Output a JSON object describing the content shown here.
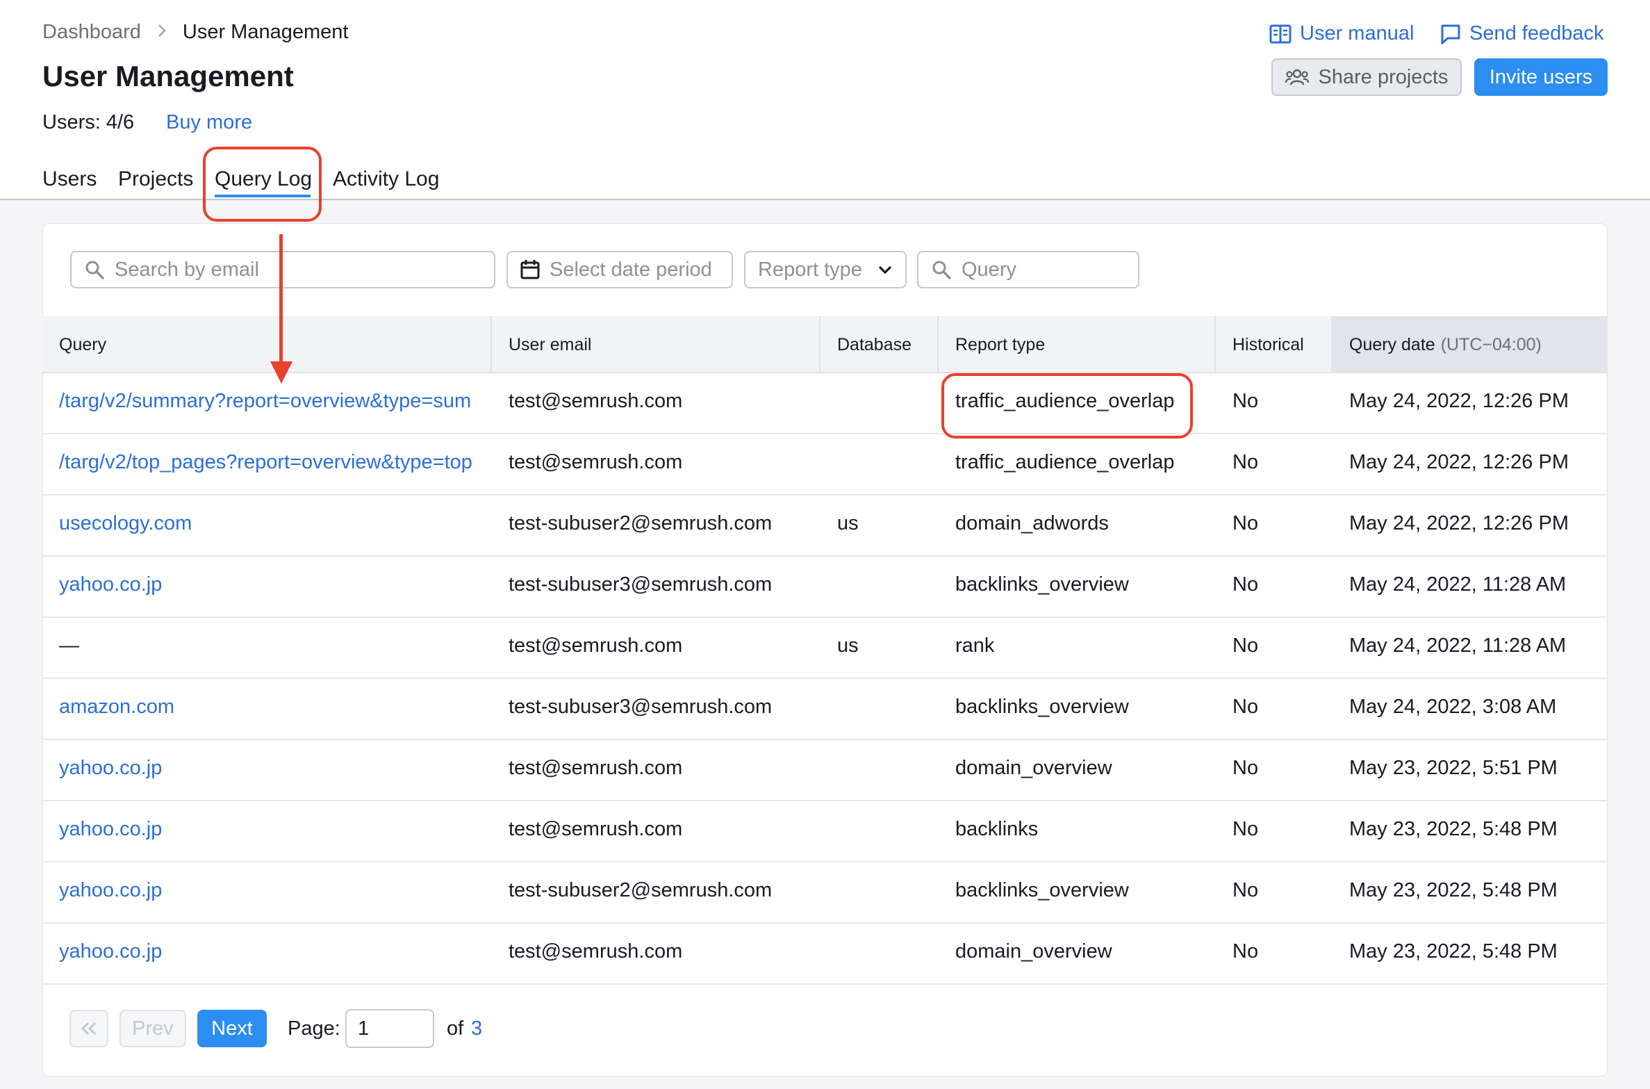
{
  "breadcrumb": {
    "root": "Dashboard",
    "current": "User Management"
  },
  "page": {
    "title": "User Management",
    "users_count": "Users: 4/6",
    "buy_more": "Buy more"
  },
  "top_links": {
    "manual": "User manual",
    "feedback": "Send feedback"
  },
  "actions": {
    "share": "Share projects",
    "invite": "Invite users"
  },
  "tabs": [
    {
      "label": "Users"
    },
    {
      "label": "Projects"
    },
    {
      "label": "Query Log",
      "active": true
    },
    {
      "label": "Activity Log"
    }
  ],
  "filters": {
    "search_email_placeholder": "Search by email",
    "date_period_placeholder": "Select date period",
    "report_type": "Report type",
    "query_placeholder": "Query"
  },
  "table": {
    "headers": {
      "query": "Query",
      "user_email": "User email",
      "database": "Database",
      "report_type": "Report type",
      "historical": "Historical",
      "query_date": "Query date",
      "query_date_tz": "(UTC−04:00)"
    },
    "rows": [
      {
        "query": "/targ/v2/summary?report=overview&type=sum",
        "email": "test@semrush.com",
        "database": "",
        "report_type": "traffic_audience_overlap",
        "historical": "No",
        "date": "May 24, 2022, 12:26 PM"
      },
      {
        "query": "/targ/v2/top_pages?report=overview&type=top",
        "email": "test@semrush.com",
        "database": "",
        "report_type": "traffic_audience_overlap",
        "historical": "No",
        "date": "May 24, 2022, 12:26 PM"
      },
      {
        "query": "usecology.com",
        "email": "test-subuser2@semrush.com",
        "database": "us",
        "report_type": "domain_adwords",
        "historical": "No",
        "date": "May 24, 2022, 12:26 PM"
      },
      {
        "query": "yahoo.co.jp",
        "email": "test-subuser3@semrush.com",
        "database": "",
        "report_type": "backlinks_overview",
        "historical": "No",
        "date": "May 24, 2022, 11:28 AM"
      },
      {
        "query": "—",
        "email": "test@semrush.com",
        "database": "us",
        "report_type": "rank",
        "historical": "No",
        "date": "May 24, 2022, 11:28 AM"
      },
      {
        "query": "amazon.com",
        "email": "test-subuser3@semrush.com",
        "database": "",
        "report_type": "backlinks_overview",
        "historical": "No",
        "date": "May 24, 2022, 3:08 AM"
      },
      {
        "query": "yahoo.co.jp",
        "email": "test@semrush.com",
        "database": "",
        "report_type": "domain_overview",
        "historical": "No",
        "date": "May 23, 2022, 5:51 PM"
      },
      {
        "query": "yahoo.co.jp",
        "email": "test@semrush.com",
        "database": "",
        "report_type": "backlinks",
        "historical": "No",
        "date": "May 23, 2022, 5:48 PM"
      },
      {
        "query": "yahoo.co.jp",
        "email": "test-subuser2@semrush.com",
        "database": "",
        "report_type": "backlinks_overview",
        "historical": "No",
        "date": "May 23, 2022, 5:48 PM"
      },
      {
        "query": "yahoo.co.jp",
        "email": "test@semrush.com",
        "database": "",
        "report_type": "domain_overview",
        "historical": "No",
        "date": "May 23, 2022, 5:48 PM"
      }
    ]
  },
  "pagination": {
    "prev": "Prev",
    "next": "Next",
    "page_label": "Page:",
    "current_page": "1",
    "of": "of",
    "total": "3"
  },
  "colors": {
    "accent": "#2b8ef0",
    "link": "#2b6fd6",
    "annotation": "#e8412c"
  }
}
